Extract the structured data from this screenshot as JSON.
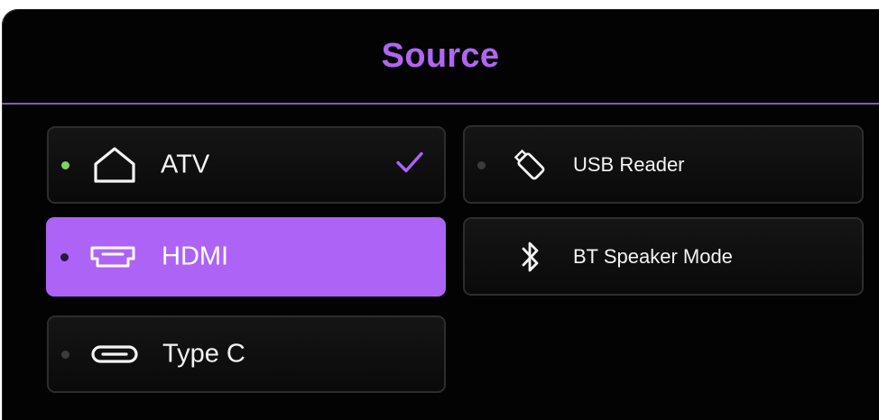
{
  "header": {
    "title": "Source"
  },
  "colors": {
    "accent": "#ad63f5",
    "title": "#b066f2",
    "active_dot": "#7fd35a",
    "background": "#030303"
  },
  "sources": [
    {
      "label": "ATV",
      "icon": "home-icon",
      "active": true,
      "checked": true,
      "focused": false
    },
    {
      "label": "HDMI",
      "icon": "hdmi-icon",
      "active": false,
      "checked": false,
      "focused": true
    },
    {
      "label": "Type C",
      "icon": "usb-c-icon",
      "active": false,
      "checked": false,
      "focused": false
    },
    {
      "label": "USB Reader",
      "icon": "usb-stick-icon",
      "active": false,
      "checked": false,
      "focused": false
    },
    {
      "label": "BT Speaker Mode",
      "icon": "bluetooth-icon",
      "active": false,
      "checked": false,
      "focused": false
    }
  ]
}
